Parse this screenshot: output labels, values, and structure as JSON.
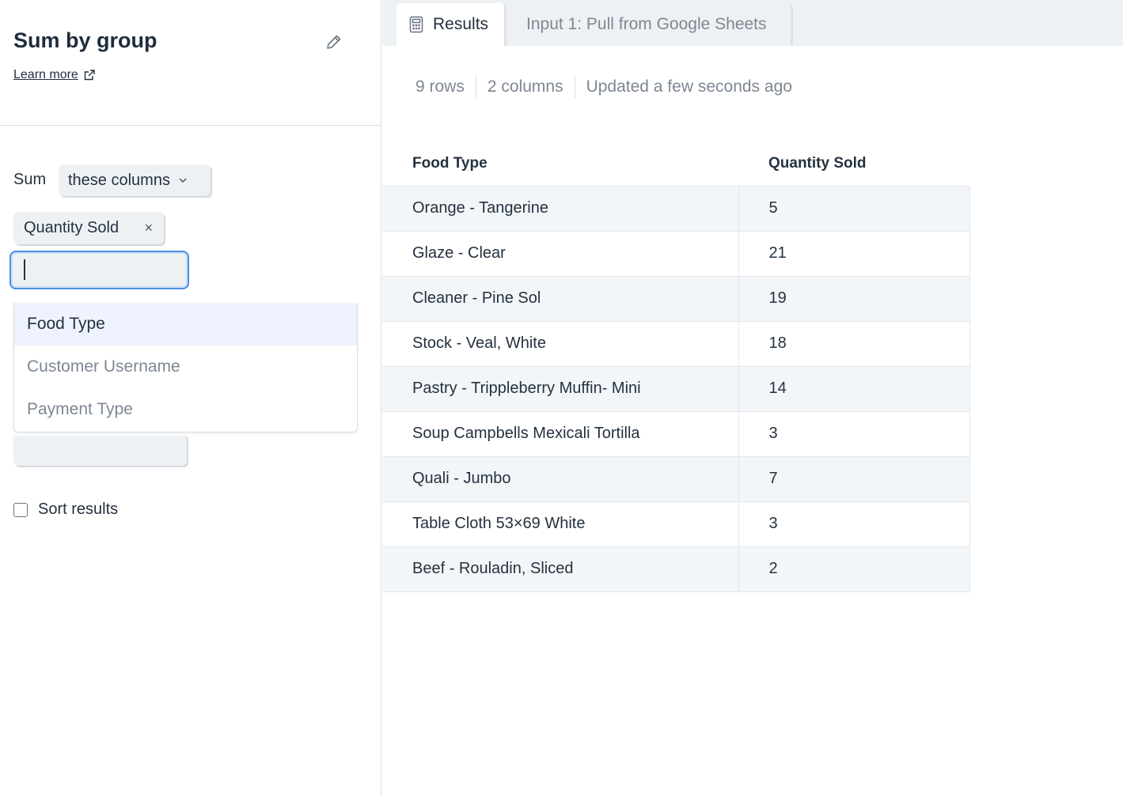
{
  "panel": {
    "title": "Sum by group",
    "learn_more": "Learn more",
    "sum_label": "Sum",
    "mode_select": "these columns",
    "selected_chip": "Quantity Sold",
    "chip_remove": "×",
    "column_input_value": "",
    "dropdown_options": [
      "Food Type",
      "Customer Username",
      "Payment Type"
    ],
    "sort_label": "Sort results"
  },
  "tabs": {
    "results": "Results",
    "input": "Input 1: Pull from Google Sheets"
  },
  "meta": {
    "rows": "9 rows",
    "columns": "2 columns",
    "updated": "Updated a few seconds ago"
  },
  "table": {
    "headers": [
      "Food Type",
      "Quantity Sold"
    ],
    "rows": [
      [
        "Orange - Tangerine",
        "5"
      ],
      [
        "Glaze - Clear",
        "21"
      ],
      [
        "Cleaner - Pine Sol",
        "19"
      ],
      [
        "Stock - Veal, White",
        "18"
      ],
      [
        "Pastry - Trippleberry Muffin- Mini",
        "14"
      ],
      [
        "Soup Campbells Mexicali Tortilla",
        "3"
      ],
      [
        "Quali - Jumbo",
        "7"
      ],
      [
        "Table Cloth 53×69 White",
        "3"
      ],
      [
        "Beef - Rouladin, Sliced",
        "2"
      ]
    ]
  },
  "colors": {
    "accent": "#4a8ee6",
    "panel_bg": "#eef1f4",
    "text": "#24313f",
    "muted": "#7d8793"
  },
  "icons": {
    "edit": "pencil-icon",
    "external": "external-link-icon",
    "chevron": "chevron-down-icon",
    "calculator": "calculator-icon"
  }
}
